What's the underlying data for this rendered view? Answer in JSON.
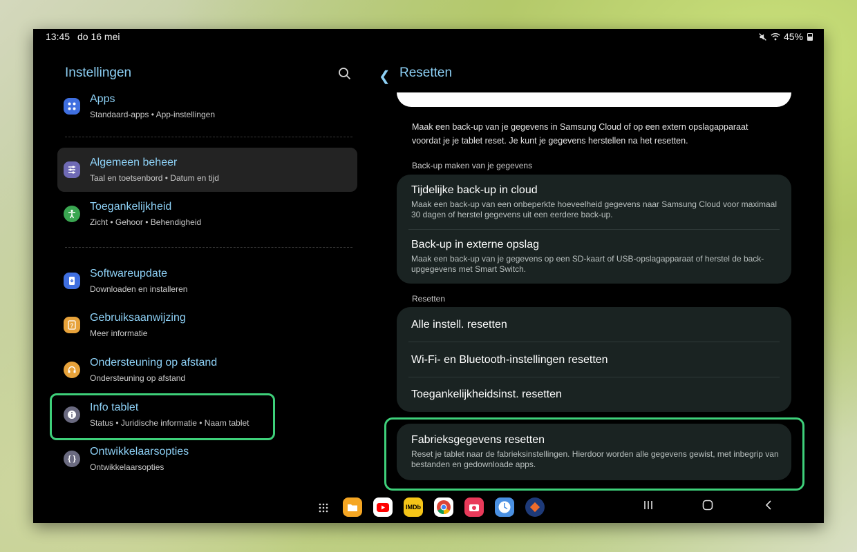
{
  "status_bar": {
    "time": "13:45",
    "date": "do 16 mei",
    "battery": "45%"
  },
  "left": {
    "title": "Instellingen",
    "items": [
      {
        "title": "Apps",
        "sub": "Standaard-apps  •  App-instellingen",
        "color": "#3f6fe0",
        "icon": "apps-icon"
      },
      {
        "title": "Algemeen beheer",
        "sub": "Taal en toetsenbord  •  Datum en tijd",
        "color": "#6f6ab5",
        "icon": "sliders-icon"
      },
      {
        "title": "Toegankelijkheid",
        "sub": "Zicht  •  Gehoor  •  Behendigheid",
        "color": "#3aa651",
        "icon": "accessibility-icon"
      },
      {
        "title": "Softwareupdate",
        "sub": "Downloaden en installeren",
        "color": "#3f6fe0",
        "icon": "update-icon"
      },
      {
        "title": "Gebruiksaanwijzing",
        "sub": "Meer informatie",
        "color": "#e7a23a",
        "icon": "manual-icon"
      },
      {
        "title": "Ondersteuning op afstand",
        "sub": "Ondersteuning op afstand",
        "color": "#e7a23a",
        "icon": "headset-icon"
      },
      {
        "title": "Info tablet",
        "sub": "Status  •  Juridische informatie  •  Naam tablet",
        "color": "#6a6a80",
        "icon": "info-icon"
      },
      {
        "title": "Ontwikkelaarsopties",
        "sub": "Ontwikkelaarsopties",
        "color": "#6a6a80",
        "icon": "code-braces-icon"
      }
    ]
  },
  "right": {
    "title": "Resetten",
    "description": "Maak een back-up van je gegevens in Samsung Cloud of op een extern opslagapparaat voordat je je tablet reset. Je kunt je gegevens herstellen na het resetten.",
    "backup_label": "Back-up maken van je gegevens",
    "backup": [
      {
        "title": "Tijdelijke back-up in cloud",
        "sub": "Maak een back-up van een onbeperkte hoeveelheid gegevens naar Samsung Cloud voor maximaal 30 dagen of herstel gegevens uit een eerdere back-up."
      },
      {
        "title": "Back-up in externe opslag",
        "sub": "Maak een back-up van je gegevens op een SD-kaart of USB-opslagapparaat of herstel de back-upgegevens met Smart Switch."
      }
    ],
    "reset_label": "Resetten",
    "reset": [
      {
        "title": "Alle instell. resetten"
      },
      {
        "title": "Wi-Fi- en Bluetooth-instellingen resetten"
      },
      {
        "title": "Toegankelijkheidsinst. resetten"
      }
    ],
    "factory": {
      "title": "Fabrieksgegevens resetten",
      "sub": "Reset je tablet naar de fabrieksinstellingen. Hierdoor worden alle gegevens gewist, met inbegrip van bestanden en gedownloade apps."
    }
  },
  "dock": {
    "apps": [
      {
        "name": "files",
        "label": "",
        "color": "#f5a623"
      },
      {
        "name": "youtube",
        "label": "",
        "color": "#ffffff"
      },
      {
        "name": "imdb",
        "label": "IMDb",
        "color": "#f5c518"
      },
      {
        "name": "chrome",
        "label": "",
        "color": "#ffffff"
      },
      {
        "name": "camera",
        "label": "",
        "color": "#e93a5a"
      },
      {
        "name": "clock",
        "label": "",
        "color": "#4a90e2"
      },
      {
        "name": "nos",
        "label": "",
        "color": "#1e3a78"
      }
    ]
  }
}
